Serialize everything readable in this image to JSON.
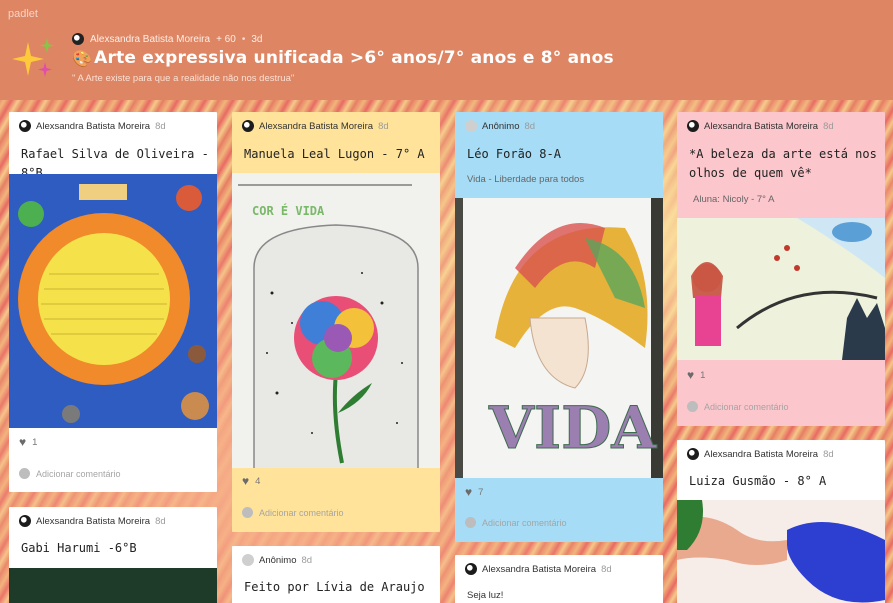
{
  "app": {
    "brand": "padlet"
  },
  "board": {
    "author": "Alexsandra Batista Moreira",
    "likes": "+ 60",
    "age": "3d",
    "title": "Arte expressiva unificada >6° anos/7° anos e 8° anos",
    "subtitle": "\" A Arte existe para que a realidade não nos destrua\""
  },
  "ui": {
    "add_comment": "Adicionar comentário"
  },
  "posts": [
    {
      "author": "Alexsandra Batista Moreira",
      "time": "8d",
      "title": "Rafael Silva de Oliveira - 8°B",
      "likes": "1"
    },
    {
      "author": "Alexsandra Batista Moreira",
      "time": "8d",
      "title": "Gabi Harumi -6°B"
    },
    {
      "author": "Alexsandra Batista Moreira",
      "time": "8d",
      "title": "Manuela Leal Lugon - 7° A",
      "likes": "4",
      "image_text": "COR É VIDA"
    },
    {
      "author": "Anônimo",
      "time": "8d",
      "title": "Feito por Lívia de Araujo"
    },
    {
      "author": "Anônimo",
      "time": "8d",
      "title": "Léo Forão 8-A",
      "subtitle": "Vida - Liberdade para todos",
      "likes": "7",
      "image_text": "VIDA"
    },
    {
      "author": "Alexsandra Batista Moreira",
      "time": "8d",
      "title": "Seja luz!"
    },
    {
      "author": "Alexsandra Batista Moreira",
      "time": "8d",
      "title": "*A beleza da arte está nos olhos de quem vê*",
      "subtitle": "Aluna: Nicoly - 7° A",
      "likes": "1"
    },
    {
      "author": "Alexsandra Batista Moreira",
      "time": "8d",
      "title": "Luiza Gusmão - 8° A"
    }
  ]
}
